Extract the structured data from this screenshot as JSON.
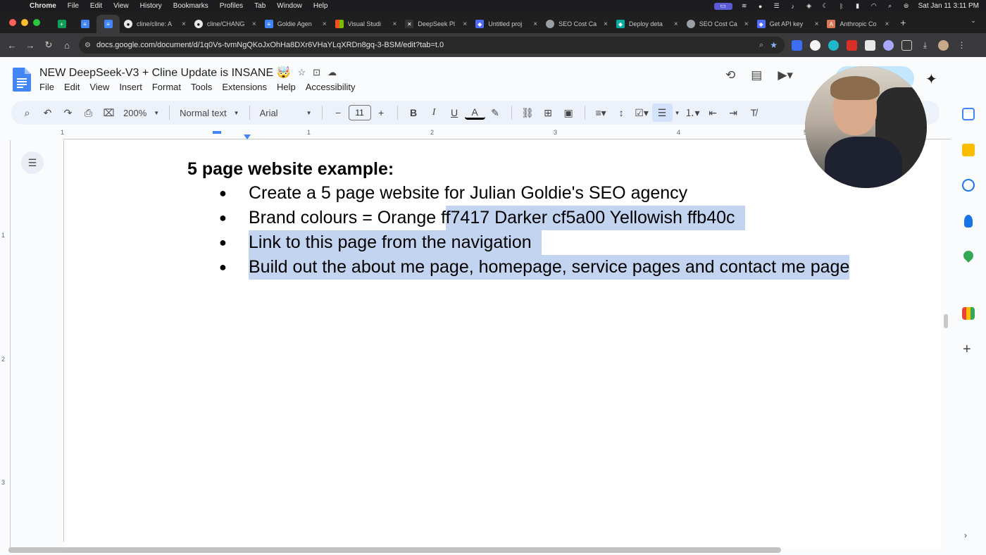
{
  "mac_menu": {
    "app": "Chrome",
    "items": [
      "File",
      "Edit",
      "View",
      "History",
      "Bookmarks",
      "Profiles",
      "Tab",
      "Window",
      "Help"
    ],
    "clock": "Sat Jan 11  3:11 PM"
  },
  "tabs": [
    {
      "title": "",
      "icon_color": "#0f9d58",
      "icon": "sheets-icon",
      "pinned": true
    },
    {
      "title": "",
      "icon_color": "#4285f4",
      "icon": "docs-icon",
      "pinned": true
    },
    {
      "title": "",
      "icon_color": "#4285f4",
      "icon": "docs-icon",
      "pinned": true,
      "active": true
    },
    {
      "title": "cline/cline: A",
      "icon_color": "#e8e8e8",
      "icon": "github-icon"
    },
    {
      "title": "cline/CHANG",
      "icon_color": "#e8e8e8",
      "icon": "github-icon"
    },
    {
      "title": "Goldie Agen",
      "icon_color": "#4285f4",
      "icon": "docs-icon"
    },
    {
      "title": "Visual Studi",
      "icon_color": "#f25022",
      "icon": "microsoft-icon"
    },
    {
      "title": "DeepSeek Pl",
      "icon_color": "#333333",
      "icon": "x-icon"
    },
    {
      "title": "Untitled proj",
      "icon_color": "#4d6bfe",
      "icon": "deepseek-icon"
    },
    {
      "title": "SEO Cost Ca",
      "icon_color": "#9aa0a6",
      "icon": "globe-icon"
    },
    {
      "title": "Deploy deta",
      "icon_color": "#00ad9f",
      "icon": "netlify-icon"
    },
    {
      "title": "SEO Cost Ca",
      "icon_color": "#9aa0a6",
      "icon": "globe-icon"
    },
    {
      "title": "Get API key",
      "icon_color": "#4d6bfe",
      "icon": "deepseek-icon"
    },
    {
      "title": "Anthropic Co",
      "icon_color": "#d97757",
      "icon": "anthropic-icon"
    }
  ],
  "address": {
    "url": "docs.google.com/document/d/1q0Vs-tvmNgQKoJxOhHa8DXr6VHaYLqXRDn8gq-3-BSM/edit?tab=t.0"
  },
  "doc": {
    "title": "NEW DeepSeek-V3 + Cline Update is INSANE 🤯",
    "menu": [
      "File",
      "Edit",
      "View",
      "Insert",
      "Format",
      "Tools",
      "Extensions",
      "Help",
      "Accessibility"
    ]
  },
  "toolbar": {
    "zoom": "200%",
    "style": "Normal text",
    "font": "Arial",
    "font_size": "11",
    "bold": "B",
    "italic": "I",
    "underline": "U",
    "text_color": "A"
  },
  "ruler": {
    "h_labels": [
      "1",
      "1",
      "2",
      "3",
      "4",
      "5"
    ],
    "v_labels": [
      "1",
      "2",
      "3"
    ]
  },
  "content": {
    "heading": "5 page website example:",
    "bullets": [
      {
        "pre": "Create a 5 page website for Julian Goldie's SEO agency",
        "sel": ""
      },
      {
        "pre": "Brand colours = Orange f",
        "sel": "f7417 Darker cf5a00 Yellowish ffb40c"
      },
      {
        "pre": "",
        "sel": "Link to this page from the navigation"
      },
      {
        "pre": "",
        "sel": "Build out the about me page, homepage, service pages and contact me page"
      }
    ]
  },
  "colors": {
    "selection": "#c3d4f0",
    "share_button": "#c2e7ff",
    "accent": "#4285f4"
  }
}
